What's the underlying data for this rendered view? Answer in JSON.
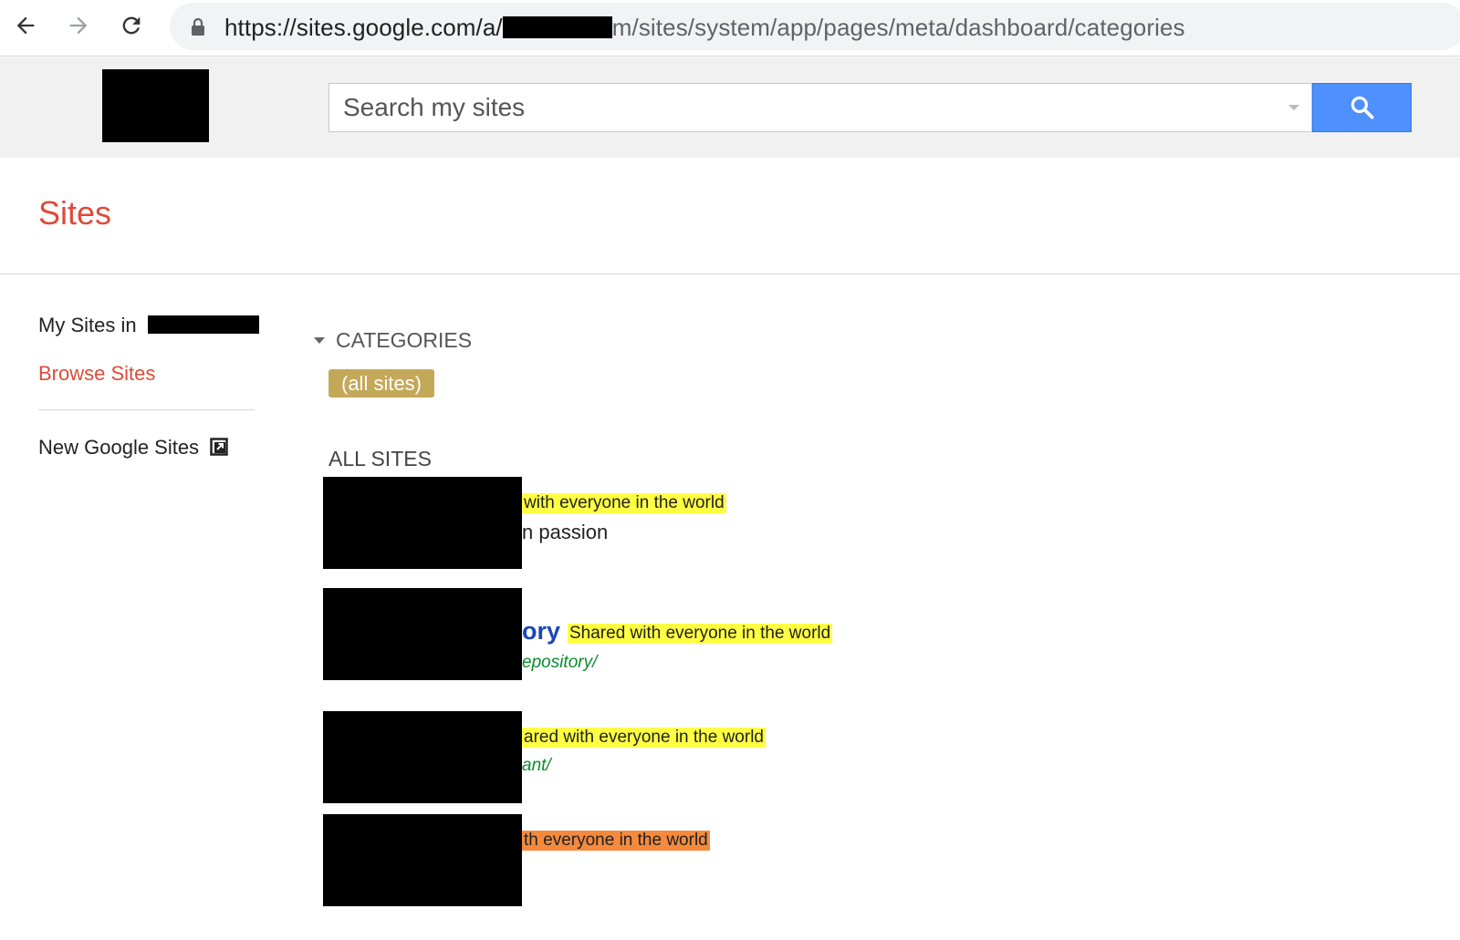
{
  "browser": {
    "url_host": "https://sites.google.com/a/",
    "url_path": "m/sites/system/app/pages/meta/dashboard/categories",
    "back_icon": "arrow-left",
    "forward_icon": "arrow-right",
    "reload_icon": "reload",
    "lock_icon": "lock"
  },
  "header": {
    "search_placeholder": "Search my sites",
    "search_icon": "magnifier",
    "accent_color": "#4d90fe"
  },
  "page": {
    "title": "Sites",
    "title_color": "#dd4b39"
  },
  "left_nav": {
    "my_sites_label": "My Sites in",
    "browse_sites_label": "Browse Sites",
    "new_google_sites_label": "New Google Sites"
  },
  "main": {
    "categories_label": "CATEGORIES",
    "chip_label": "(all sites)",
    "all_sites_label": "ALL SITES",
    "sites": [
      {
        "badge": "with everyone in the world",
        "badge_color": "#ffff44",
        "description": "n passion"
      },
      {
        "title": "ory",
        "badge": "Shared with everyone in the world",
        "badge_color": "#ffff44",
        "url": "epository/"
      },
      {
        "badge": "ared with everyone in the world",
        "badge_color": "#ffff44",
        "url": "ant/"
      },
      {
        "badge": "th everyone in the world",
        "badge_color": "#f58a3e"
      }
    ]
  }
}
